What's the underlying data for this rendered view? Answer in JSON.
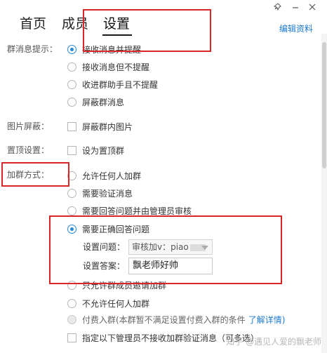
{
  "tabs": [
    {
      "label": "首页"
    },
    {
      "label": "成员"
    },
    {
      "label": "设置"
    }
  ],
  "edit_link": "编辑资料",
  "icons": {
    "pin": "pin-icon",
    "close": "close-icon"
  },
  "sections": {
    "message_prompt": {
      "label": "群消息提示：",
      "options": [
        "接收消息并提醒",
        "接收消息但不提醒",
        "收进群助手且不提醒",
        "屏蔽群消息"
      ],
      "selected_index": 0
    },
    "image_block": {
      "label": "图片屏蔽：",
      "checkbox": "屏蔽群内图片"
    },
    "pin": {
      "label": "置顶设置：",
      "checkbox": "设为置顶群"
    },
    "join_method": {
      "label": "加群方式：",
      "options": [
        "允许任何人加群",
        "需要验证消息",
        "需要回答问题并由管理员审核",
        "需要正确回答问题",
        "只允许群成员邀请加群",
        "不允许任何人加群",
        "付费入群(本群暂不满足设置付费入群的条件"
      ],
      "paid_link": "了解详情)",
      "selected_index": 3,
      "question_label": "设置问题：",
      "question_value": "审核加v：piao",
      "answer_label": "设置答案：",
      "answer_value": "飘老师好帅"
    },
    "admin_option": "指定以下管理员不接收加群验证消息（可多选）"
  },
  "watermark": "知乎 @遇见人爱的飘老师",
  "colors": {
    "accent": "#2a86d6",
    "link": "#1e7bd0",
    "highlight": "#d9262b"
  }
}
